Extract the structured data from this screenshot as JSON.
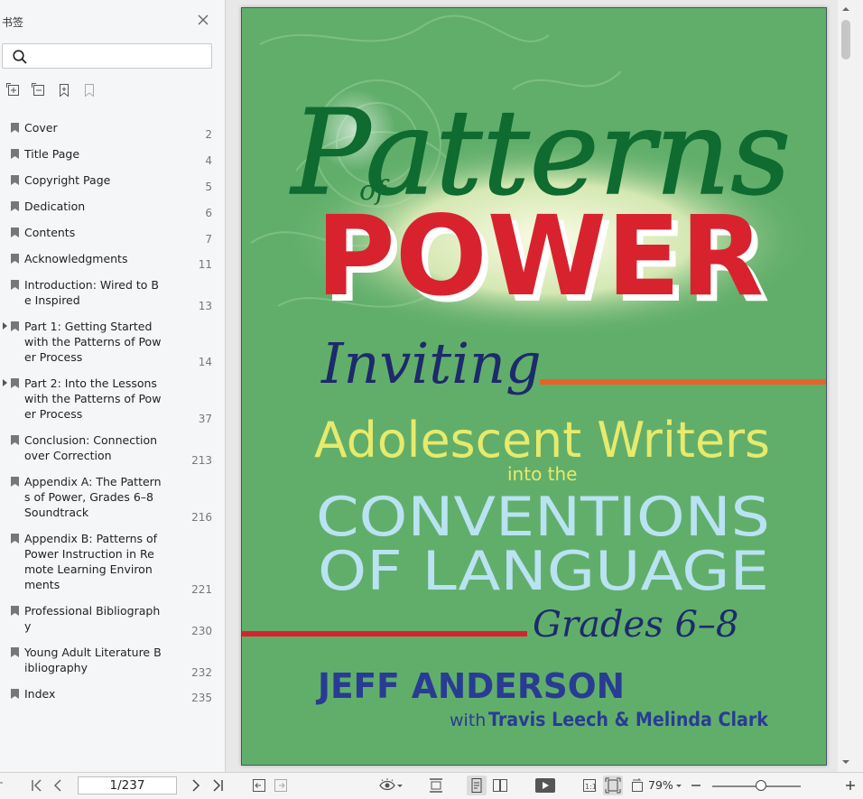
{
  "sidebar": {
    "title": "书签",
    "search_placeholder": "",
    "bookmarks": [
      {
        "label": "Cover",
        "page": "2"
      },
      {
        "label": "Title Page",
        "page": "4"
      },
      {
        "label": "Copyright Page",
        "page": "5"
      },
      {
        "label": "Dedication",
        "page": "6"
      },
      {
        "label": "Contents",
        "page": "7"
      },
      {
        "label": "Acknowledgments",
        "page": "11"
      },
      {
        "label": "Introduction: Wired to Be Inspired",
        "page": "13"
      },
      {
        "label": "Part 1: Getting Started with the Patterns of Power Process",
        "page": "14"
      },
      {
        "label": "Part 2: Into the Lessons with the Patterns of Power Process",
        "page": "37"
      },
      {
        "label": "Conclusion: Connection over Correction",
        "page": "213"
      },
      {
        "label": "Appendix A: The Patterns of Power, Grades 6–8 Soundtrack",
        "page": "216"
      },
      {
        "label": "Appendix B: Patterns of Power Instruction in Remote Learning Environments",
        "page": "221"
      },
      {
        "label": "Professional Bibliography",
        "page": "230"
      },
      {
        "label": "Young Adult Literature Bibliography",
        "page": "232"
      },
      {
        "label": "Index",
        "page": "235"
      }
    ]
  },
  "cover": {
    "title_script": "Patterns",
    "title_of": "of",
    "title_power": "POWER",
    "inviting": "Inviting",
    "line1": "Adolescent Writers",
    "into_the": "into the",
    "conventions": "CONVENTIONS",
    "of_language": "OF LANGUAGE",
    "grades": "Grades 6–8",
    "author": "JEFF ANDERSON",
    "with": "with",
    "coauthors": "Travis Leech & Melinda Clark"
  },
  "toolbar": {
    "page_value": "1/237",
    "zoom": "79%"
  },
  "colors": {
    "cover_bg": "#61ae6b",
    "power_red": "#d8232f",
    "script_green": "#0f6b30",
    "navy": "#1d2a6b",
    "conventions_blue": "#b9e3f2",
    "adolescent_yellow": "#e7ea6b",
    "rule_orange": "#e7622a"
  }
}
